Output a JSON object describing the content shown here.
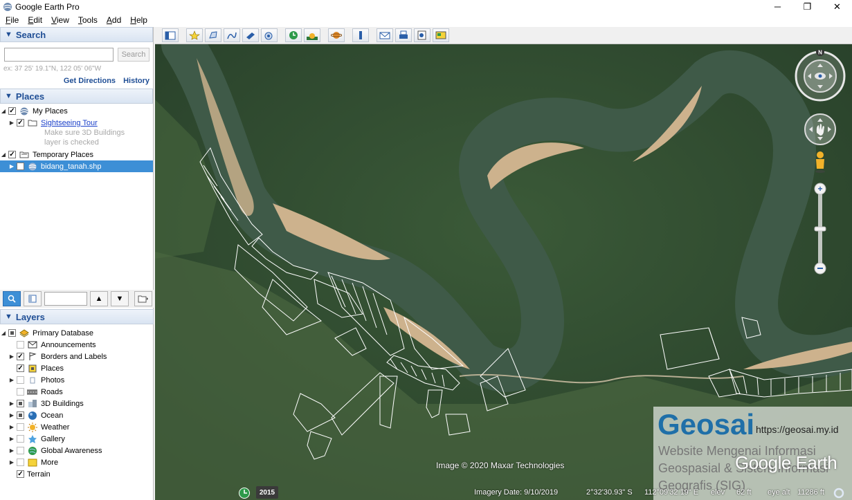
{
  "window": {
    "title": "Google Earth Pro",
    "minimize": "─",
    "restore": "❐",
    "close": "✕"
  },
  "menu": [
    "File",
    "Edit",
    "View",
    "Tools",
    "Add",
    "Help"
  ],
  "search": {
    "header": "Search",
    "button": "Search",
    "placeholder": "",
    "example": "ex: 37 25' 19.1\"N, 122 05' 06\"W",
    "get_directions": "Get Directions",
    "history": "History"
  },
  "places": {
    "header": "Places",
    "my_places": "My Places",
    "sightseeing": "Sightseeing Tour",
    "hint_line1": "Make sure 3D Buildings",
    "hint_line2": "layer is checked",
    "temporary": "Temporary Places",
    "file": "bidang_tanah.shp"
  },
  "layers": {
    "header": "Layers",
    "items": [
      {
        "label": "Primary Database",
        "checked": "partial"
      },
      {
        "label": "Announcements",
        "checked": "no"
      },
      {
        "label": "Borders and Labels",
        "checked": "yes"
      },
      {
        "label": "Places",
        "checked": "yes"
      },
      {
        "label": "Photos",
        "checked": "no"
      },
      {
        "label": "Roads",
        "checked": "no"
      },
      {
        "label": "3D Buildings",
        "checked": "partial"
      },
      {
        "label": "Ocean",
        "checked": "partial"
      },
      {
        "label": "Weather",
        "checked": "no"
      },
      {
        "label": "Gallery",
        "checked": "no"
      },
      {
        "label": "Global Awareness",
        "checked": "no"
      },
      {
        "label": "More",
        "checked": "no"
      },
      {
        "label": "Terrain",
        "checked": "yes"
      }
    ]
  },
  "map": {
    "attribution": "Image © 2020 Maxar Technologies",
    "year": "2015",
    "imagery_date": "Imagery Date: 9/10/2019",
    "lat": "2°32'30.93\" S",
    "lon": "112°09'32.19\" E",
    "elev_label": "elev",
    "elev_value": "62 ft",
    "eye_alt_label": "eye alt",
    "eye_alt_value": "11286 ft",
    "logo": "Google Earth",
    "compass_n": "N"
  },
  "watermark": {
    "brand": "Geosai",
    "url": "https://geosai.my.id",
    "tagline": "Website Mengenai Informasi Geospasial & Sistem Informasi Geografis (SIG)"
  },
  "colors": {
    "accent": "#1f4e95",
    "selection": "#3d8fd6",
    "forest": "#2f4a2e",
    "river": "#3f5a48",
    "sandbar": "#c9b08c"
  }
}
